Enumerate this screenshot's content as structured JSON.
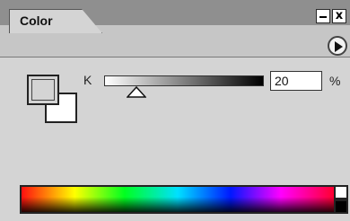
{
  "panel": {
    "tab_label": "Color",
    "controls": {
      "minimize_icon": "minimize-icon",
      "close_icon": "close-icon",
      "close_glyph": "x",
      "menu_icon": "panel-menu-icon"
    }
  },
  "color": {
    "channel_label": "K",
    "value": "20",
    "unit": "%",
    "slider_value_fraction": 0.2,
    "foreground_swatch": "#d4d4d4",
    "background_swatch": "#ffffff"
  },
  "spectrum": {
    "gradient_colors": [
      "#ff1010",
      "#ffff00",
      "#00ff20",
      "#00e0ff",
      "#0018ff",
      "#ff00ff",
      "#ff0030"
    ],
    "white_swatch": "#ffffff",
    "black_swatch": "#000000"
  }
}
